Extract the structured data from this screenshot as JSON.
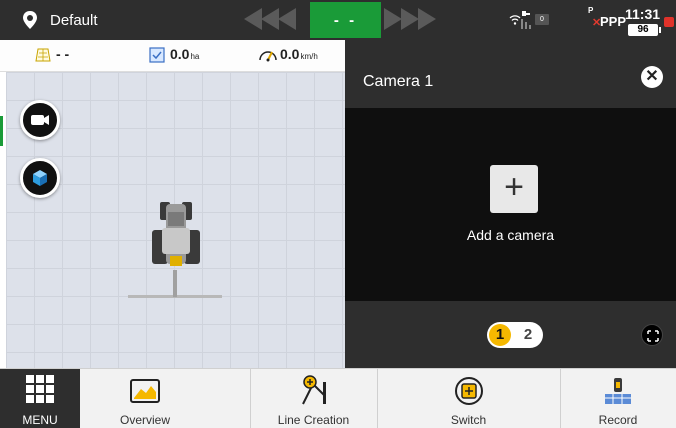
{
  "topbar": {
    "profile_name": "Default",
    "status_text": "- -",
    "status_color": "#1a9b38",
    "satellite_count": "0",
    "correction_prefix": "P",
    "correction_label": "PPP",
    "correction_error_mark": "✕",
    "time": "11:31",
    "battery": "96"
  },
  "infobar": {
    "field_value": "- -",
    "area_value": "0.0",
    "area_unit": "ha",
    "speed_value": "0.0",
    "speed_unit": "km/h"
  },
  "camera": {
    "title": "Camera 1",
    "add_plus": "+",
    "add_label": "Add a camera",
    "close_glyph": "✕",
    "pages": [
      "1",
      "2"
    ],
    "active_page": "1",
    "accent": "#f5b800"
  },
  "nav": {
    "menu_label": "MENU",
    "items": [
      {
        "label": "Overview",
        "icon": "overview-icon"
      },
      {
        "label": "Line Creation",
        "icon": "line-creation-icon"
      },
      {
        "label": "Switch",
        "icon": "switch-icon"
      },
      {
        "label": "Record",
        "icon": "record-icon"
      }
    ]
  }
}
